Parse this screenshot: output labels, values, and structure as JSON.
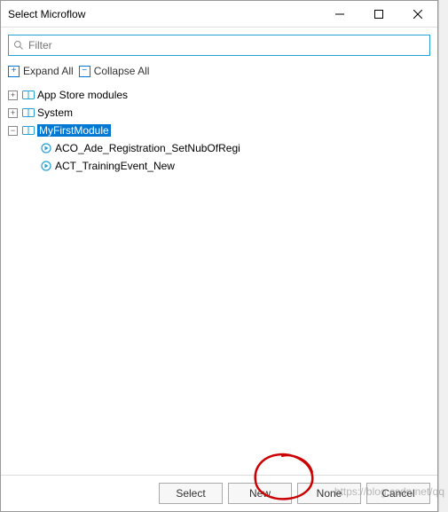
{
  "title": "Select Microflow",
  "filter": {
    "placeholder": "Filter"
  },
  "toolbar": {
    "expand_all": "Expand All",
    "collapse_all": "Collapse All"
  },
  "tree": {
    "nodes": [
      {
        "label": "App Store modules",
        "expanded": false
      },
      {
        "label": "System",
        "expanded": false
      },
      {
        "label": "MyFirstModule",
        "expanded": true,
        "selected": true
      }
    ],
    "children": [
      {
        "label": "ACO_Ade_Registration_SetNubOfRegi"
      },
      {
        "label": "ACT_TrainingEvent_New"
      }
    ]
  },
  "buttons": {
    "select": "Select",
    "new": "New",
    "none": "None",
    "cancel": "Cancel"
  },
  "watermark": "https://blog.csdn.net/qq"
}
